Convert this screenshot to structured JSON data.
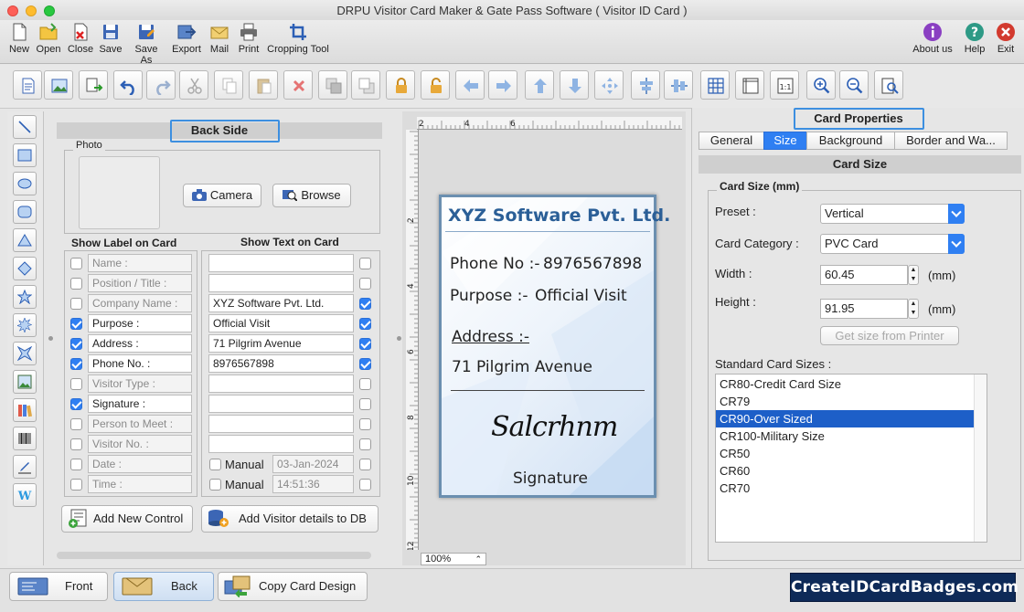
{
  "window": {
    "title": "DRPU Visitor Card Maker & Gate Pass Software ( Visitor ID Card )"
  },
  "toolbar_main": [
    {
      "label": "New",
      "icon": "new-document-icon"
    },
    {
      "label": "Open",
      "icon": "open-folder-icon"
    },
    {
      "label": "Close",
      "icon": "close-document-icon"
    },
    {
      "label": "Save",
      "icon": "save-icon"
    },
    {
      "label": "Save As",
      "icon": "save-as-icon"
    },
    {
      "label": "Export",
      "icon": "export-icon"
    },
    {
      "label": "Mail",
      "icon": "mail-icon"
    },
    {
      "label": "Print",
      "icon": "printer-icon"
    },
    {
      "label": "Cropping Tool",
      "icon": "crop-icon"
    }
  ],
  "toolbar_right": [
    {
      "label": "About us",
      "icon": "info-icon",
      "color": "#8a3fc2"
    },
    {
      "label": "Help",
      "icon": "help-icon",
      "color": "#2e9a86"
    },
    {
      "label": "Exit",
      "icon": "exit-icon",
      "color": "#d23a2e"
    }
  ],
  "back_side": {
    "header": "Back Side",
    "photo_label": "Photo",
    "camera_button": "Camera",
    "browse_button": "Browse",
    "show_label_header": "Show Label on Card",
    "show_text_header": "Show Text on Card",
    "rows": [
      {
        "label": "Name :",
        "label_checked": false,
        "text": "",
        "text_checked": false
      },
      {
        "label": "Position / Title :",
        "label_checked": false,
        "text": "",
        "text_checked": false
      },
      {
        "label": "Company Name :",
        "label_checked": false,
        "text": "XYZ Software Pvt. Ltd.",
        "text_checked": true
      },
      {
        "label": "Purpose :",
        "label_checked": true,
        "text": "Official Visit",
        "text_checked": true
      },
      {
        "label": "Address :",
        "label_checked": true,
        "text": "71 Pilgrim Avenue",
        "text_checked": true
      },
      {
        "label": "Phone No. :",
        "label_checked": true,
        "text": "8976567898",
        "text_checked": true
      },
      {
        "label": "Visitor Type :",
        "label_checked": false,
        "text": "",
        "text_checked": false
      },
      {
        "label": "Signature :",
        "label_checked": true,
        "text": "",
        "text_checked": false
      },
      {
        "label": "Person to Meet :",
        "label_checked": false,
        "text": "",
        "text_checked": false
      },
      {
        "label": "Visitor No. :",
        "label_checked": false,
        "text": "",
        "text_checked": false
      },
      {
        "label": "Date :",
        "label_checked": false,
        "text": "03-Jan-2024",
        "text_checked": false,
        "manual": "Manual"
      },
      {
        "label": "Time :",
        "label_checked": false,
        "text": "14:51:36",
        "text_checked": false,
        "manual": "Manual"
      }
    ],
    "add_control_button": "Add New Control",
    "add_visitor_button": "Add Visitor details to DB"
  },
  "canvas": {
    "zoom": "100%",
    "ruler_h": [
      "2",
      "4",
      "6"
    ],
    "ruler_v": [
      "2",
      "4",
      "6",
      "8",
      "10",
      "12"
    ]
  },
  "card": {
    "company": "XYZ Software Pvt. Ltd.",
    "phone_label": "Phone No :-",
    "phone_value": "8976567898",
    "purpose_label": "Purpose :-",
    "purpose_value": "Official Visit",
    "address_label": "Address :-",
    "address_value": "71 Pilgrim Avenue",
    "signature_label": "Signature",
    "signature_script": "Salcrhnm"
  },
  "card_properties": {
    "header": "Card Properties",
    "tabs": [
      "General",
      "Size",
      "Background",
      "Border and Wa..."
    ],
    "selected_tab": "Size",
    "section_title": "Card Size",
    "group_title": "Card Size (mm)",
    "preset_label": "Preset :",
    "preset_value": "Vertical",
    "category_label": "Card Category :",
    "category_value": "PVC Card",
    "width_label": "Width :",
    "width_value": "60.45",
    "height_label": "Height :",
    "height_value": "91.95",
    "unit": "(mm)",
    "printer_button": "Get size from Printer",
    "standard_label": "Standard Card Sizes :",
    "standard_sizes": [
      "CR80-Credit Card Size",
      "CR79",
      "CR90-Over Sized",
      "CR100-Military Size",
      "CR50",
      "CR60",
      "CR70"
    ],
    "selected_size": "CR90-Over Sized"
  },
  "bottom": {
    "front": "Front",
    "back": "Back",
    "copy": "Copy Card Design",
    "brand": "CreateIDCardBadges.com"
  },
  "colors": {
    "accent": "#2f7ff2",
    "selection": "#1d5fc8",
    "brand_bg": "#0e2a58",
    "card_border": "#6b8fb0"
  }
}
